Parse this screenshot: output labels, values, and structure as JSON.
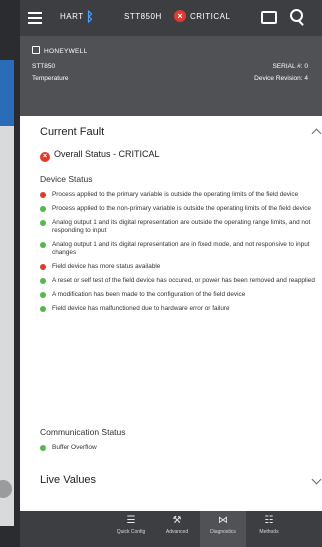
{
  "topbar": {
    "hart_label": "HART",
    "device_tag": "STT850H",
    "status": "CRITICAL",
    "icons": [
      "menu-icon",
      "bluetooth-icon",
      "critical-icon",
      "message-icon",
      "search-icon"
    ]
  },
  "device": {
    "manufacturer": "HONEYWELL",
    "model": "STT850",
    "type": "Temperature",
    "serial": "SERIAL #: 0",
    "revision": "Device Revision: 4"
  },
  "current_fault": {
    "title": "Current Fault",
    "overall_status": "Overall Status - CRITICAL",
    "device_status_title": "Device Status",
    "device_status": [
      {
        "text": "Process applied to the primary variable is outside the operating limits of the field device",
        "level": "critical"
      },
      {
        "text": "Process applied to the non-primary variable is outside the operating limits of the field device",
        "level": "ok"
      },
      {
        "text": "Analog output 1 and its digital representation are outside the operating range limits, and not responding to input",
        "level": "ok"
      },
      {
        "text": "Analog output 1 and its digital representation are in fixed mode, and not responsive to input changes",
        "level": "ok"
      },
      {
        "text": "Field device has more status available",
        "level": "critical"
      },
      {
        "text": "A reset or self test of the field device has occured, or power has been removed and reapplied",
        "level": "ok"
      },
      {
        "text": "A modification has been made to the configuration of the field device",
        "level": "ok"
      },
      {
        "text": "Field device has malfunctioned due to hardware error or failure",
        "level": "ok"
      }
    ],
    "communication_status_title": "Communication Status",
    "communication_status": [
      {
        "text": "Buffer Overflow",
        "level": "ok"
      }
    ]
  },
  "live_values": {
    "title": "Live Values"
  },
  "bottom_nav": [
    {
      "label": "Quick Config",
      "icon": "sliders-icon",
      "active": false
    },
    {
      "label": "Advanced",
      "icon": "wrench-icon",
      "active": false
    },
    {
      "label": "Diagnostics",
      "icon": "diagnostics-icon",
      "active": true
    },
    {
      "label": "Methods",
      "icon": "methods-icon",
      "active": false
    }
  ],
  "colors": {
    "critical": "#e23b2e",
    "ok": "#54b948",
    "topbar": "#3c3e41",
    "infobar": "#4f5154"
  }
}
